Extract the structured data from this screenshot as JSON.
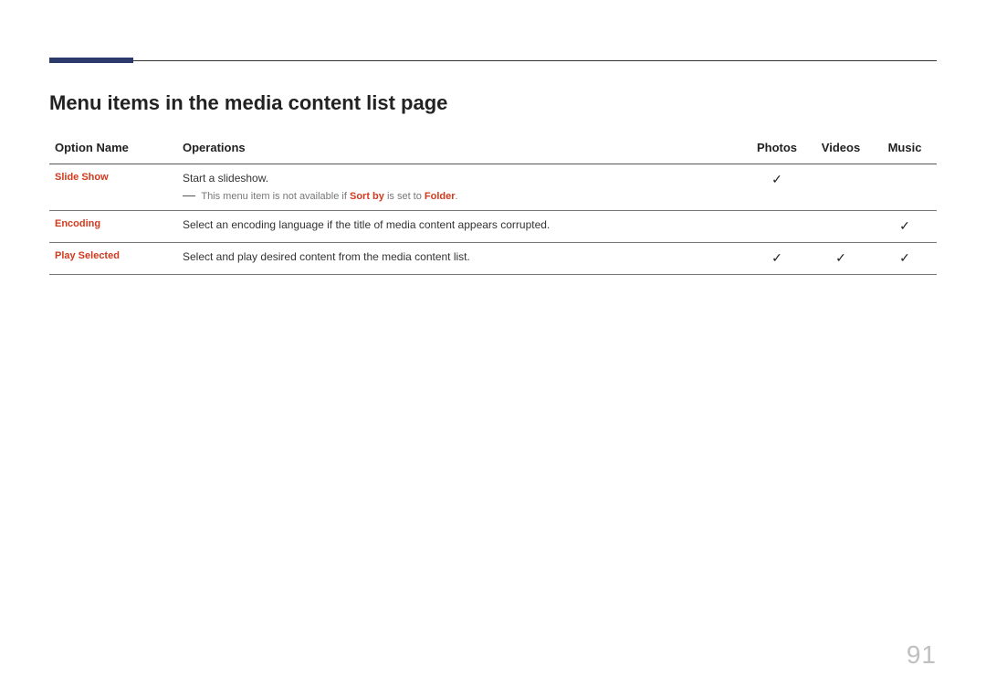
{
  "section": {
    "title": "Menu items in the media content list page"
  },
  "table": {
    "headers": {
      "option": "Option Name",
      "operations": "Operations",
      "photos": "Photos",
      "videos": "Videos",
      "music": "Music"
    },
    "check": "✓",
    "rows": {
      "slideshow": {
        "name": "Slide Show",
        "desc": "Start a slideshow.",
        "note_prefix": "This menu item is not available if ",
        "note_key1": "Sort by",
        "note_mid": " is set to ",
        "note_key2": "Folder",
        "note_suffix": ".",
        "photos": true,
        "videos": false,
        "music": false
      },
      "encoding": {
        "name": "Encoding",
        "desc": "Select an encoding language if the title of media content appears corrupted.",
        "photos": false,
        "videos": false,
        "music": true
      },
      "playselected": {
        "name": "Play Selected",
        "desc": "Select and play desired content from the media content list.",
        "photos": true,
        "videos": true,
        "music": true
      }
    }
  },
  "page_number": "91"
}
